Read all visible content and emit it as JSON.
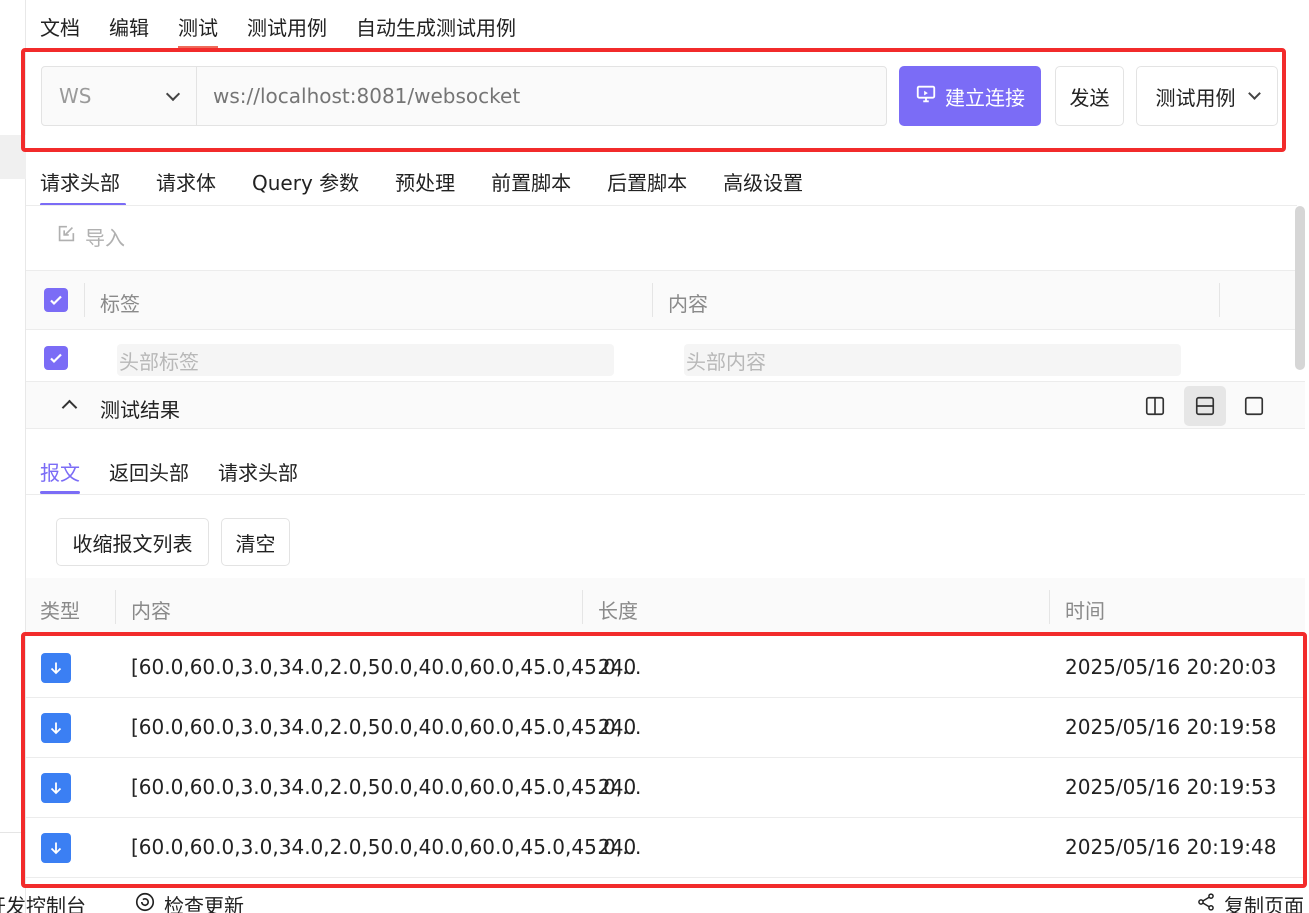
{
  "top_tabs": [
    {
      "label": "文档"
    },
    {
      "label": "编辑"
    },
    {
      "label": "测试",
      "active": true
    },
    {
      "label": "测试用例"
    },
    {
      "label": "自动生成测试用例"
    }
  ],
  "request": {
    "method": "WS",
    "url_placeholder": "ws://localhost:8081/websocket",
    "connect_label": "建立连接",
    "send_label": "发送",
    "testcase_label": "测试用例"
  },
  "req_tabs": [
    "请求头部",
    "请求体",
    "Query 参数",
    "预处理",
    "前置脚本",
    "后置脚本",
    "高级设置"
  ],
  "headers_panel": {
    "import_label": "导入",
    "col_label": "标签",
    "col_content": "内容",
    "label_placeholder": "头部标签",
    "content_placeholder": "头部内容"
  },
  "result": {
    "title": "测试结果",
    "tabs": [
      "报文",
      "返回头部",
      "请求头部"
    ],
    "collapse_label": "收缩报文列表",
    "clear_label": "清空",
    "columns": {
      "type": "类型",
      "content": "内容",
      "length": "长度",
      "time": "时间"
    },
    "rows": [
      {
        "content": "[60.0,60.0,3.0,34.0,2.0,50.0,40.0,60.0,45.0,45.0,...",
        "length": "240",
        "time": "2025/05/16 20:20:03"
      },
      {
        "content": "[60.0,60.0,3.0,34.0,2.0,50.0,40.0,60.0,45.0,45.0,...",
        "length": "240",
        "time": "2025/05/16 20:19:58"
      },
      {
        "content": "[60.0,60.0,3.0,34.0,2.0,50.0,40.0,60.0,45.0,45.0,...",
        "length": "240",
        "time": "2025/05/16 20:19:53"
      },
      {
        "content": "[60.0,60.0,3.0,34.0,2.0,50.0,40.0,60.0,45.0,45.0,...",
        "length": "240",
        "time": "2025/05/16 20:19:48"
      }
    ]
  },
  "footer": {
    "devtools_label": "开发控制台",
    "update_label": "检查更新",
    "copy_label": "复制页面"
  },
  "colors": {
    "accent": "#7b6cf6",
    "highlight_box": "#f22b2b",
    "download_icon": "#3b7ff3"
  }
}
